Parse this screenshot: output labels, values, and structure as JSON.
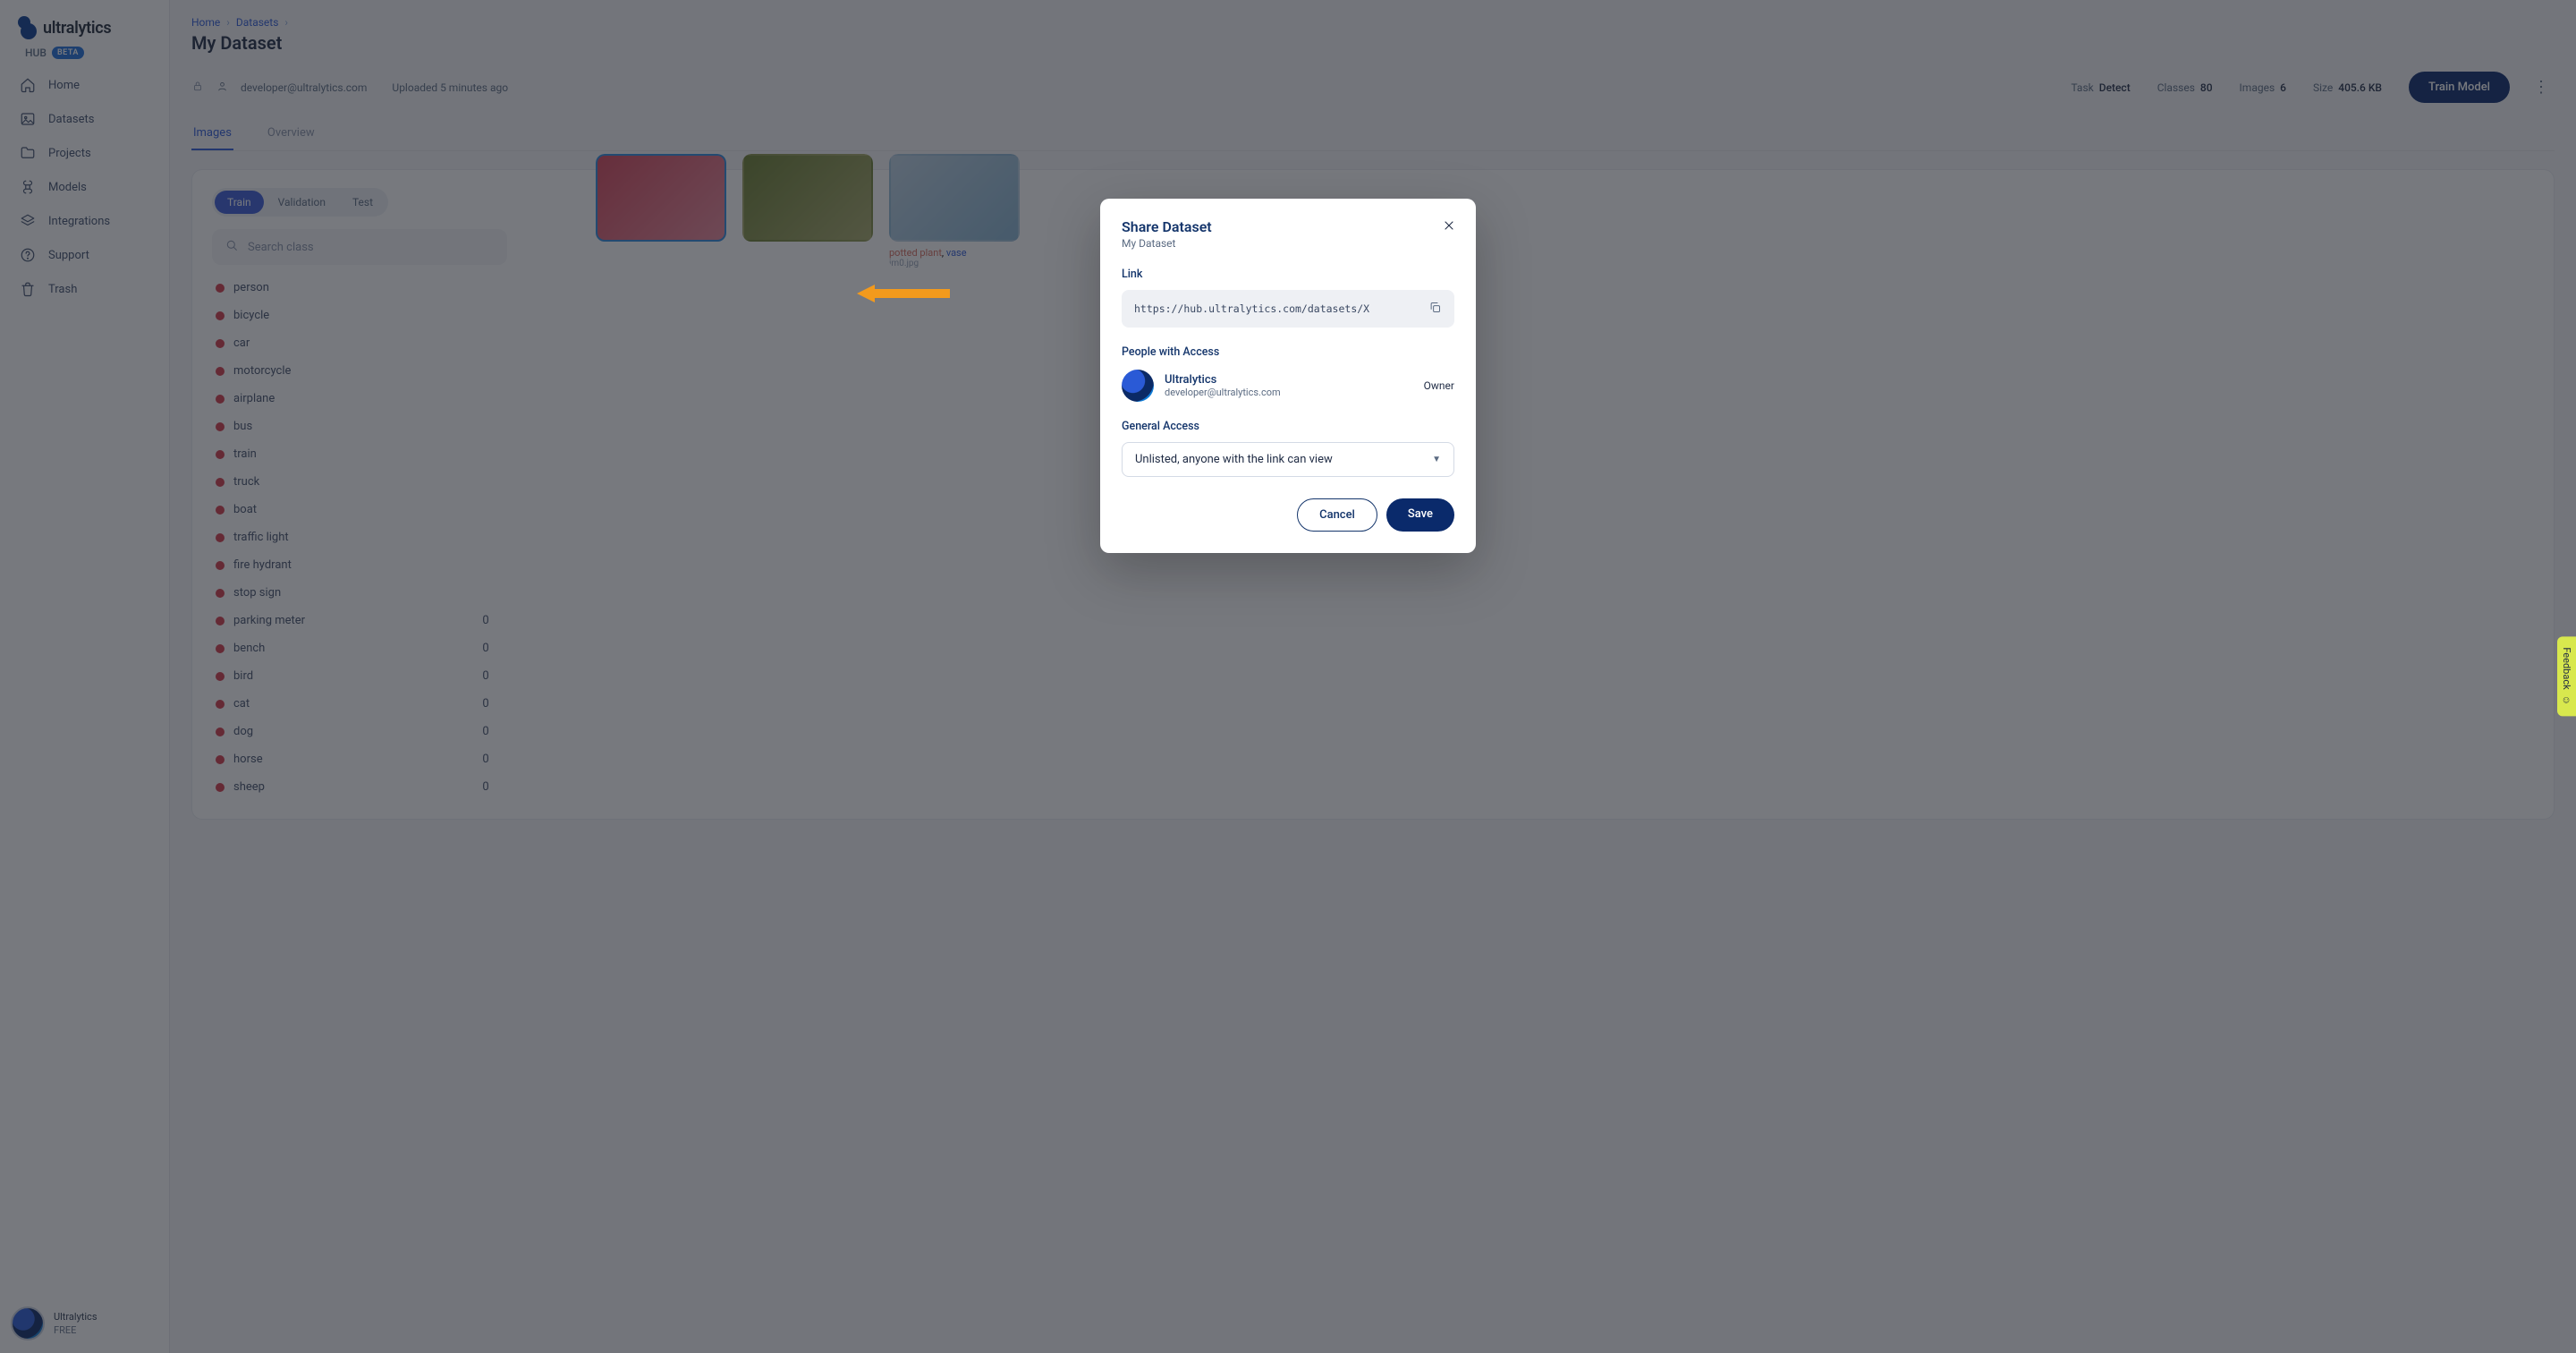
{
  "brand": {
    "name": "ultralytics",
    "hub": "HUB",
    "beta": "BETA"
  },
  "sidebar": {
    "items": [
      {
        "label": "Home"
      },
      {
        "label": "Datasets"
      },
      {
        "label": "Projects"
      },
      {
        "label": "Models"
      },
      {
        "label": "Integrations"
      },
      {
        "label": "Support"
      },
      {
        "label": "Trash"
      }
    ]
  },
  "user": {
    "name": "Ultralytics",
    "plan": "FREE"
  },
  "breadcrumbs": {
    "home": "Home",
    "datasets": "Datasets"
  },
  "page": {
    "title": "My Dataset",
    "owner": "developer@ultralytics.com",
    "uploaded": "Uploaded 5 minutes ago",
    "train_button": "Train Model"
  },
  "stats": {
    "task_lbl": "Task",
    "task": "Detect",
    "classes_lbl": "Classes",
    "classes": "80",
    "images_lbl": "Images",
    "images": "6",
    "size_lbl": "Size",
    "size": "405.6 KB"
  },
  "tabs": {
    "images": "Images",
    "overview": "Overview"
  },
  "splits": {
    "train": "Train",
    "val": "Validation",
    "test": "Test"
  },
  "search_placeholder": "Search class",
  "classes": [
    {
      "name": "person",
      "count": ""
    },
    {
      "name": "bicycle",
      "count": ""
    },
    {
      "name": "car",
      "count": ""
    },
    {
      "name": "motorcycle",
      "count": ""
    },
    {
      "name": "airplane",
      "count": ""
    },
    {
      "name": "bus",
      "count": ""
    },
    {
      "name": "train",
      "count": ""
    },
    {
      "name": "truck",
      "count": ""
    },
    {
      "name": "boat",
      "count": ""
    },
    {
      "name": "traffic light",
      "count": ""
    },
    {
      "name": "fire hydrant",
      "count": ""
    },
    {
      "name": "stop sign",
      "count": ""
    },
    {
      "name": "parking meter",
      "count": "0"
    },
    {
      "name": "bench",
      "count": "0"
    },
    {
      "name": "bird",
      "count": "0"
    },
    {
      "name": "cat",
      "count": "0"
    },
    {
      "name": "dog",
      "count": "0"
    },
    {
      "name": "horse",
      "count": "0"
    },
    {
      "name": "sheep",
      "count": "0"
    }
  ],
  "thumb": {
    "tags": {
      "potted": "potted plant",
      "vase": "vase",
      "sep": ", "
    },
    "file": "im0.jpg"
  },
  "modal": {
    "title": "Share Dataset",
    "subtitle": "My Dataset",
    "link_label": "Link",
    "link_value": "https://hub.ultralytics.com/datasets/X",
    "people_label": "People with Access",
    "person_name": "Ultralytics",
    "person_email": "developer@ultralytics.com",
    "person_role": "Owner",
    "general_label": "General Access",
    "general_value": "Unlisted, anyone with the link can view",
    "cancel": "Cancel",
    "save": "Save"
  },
  "feedback": "Feedback"
}
